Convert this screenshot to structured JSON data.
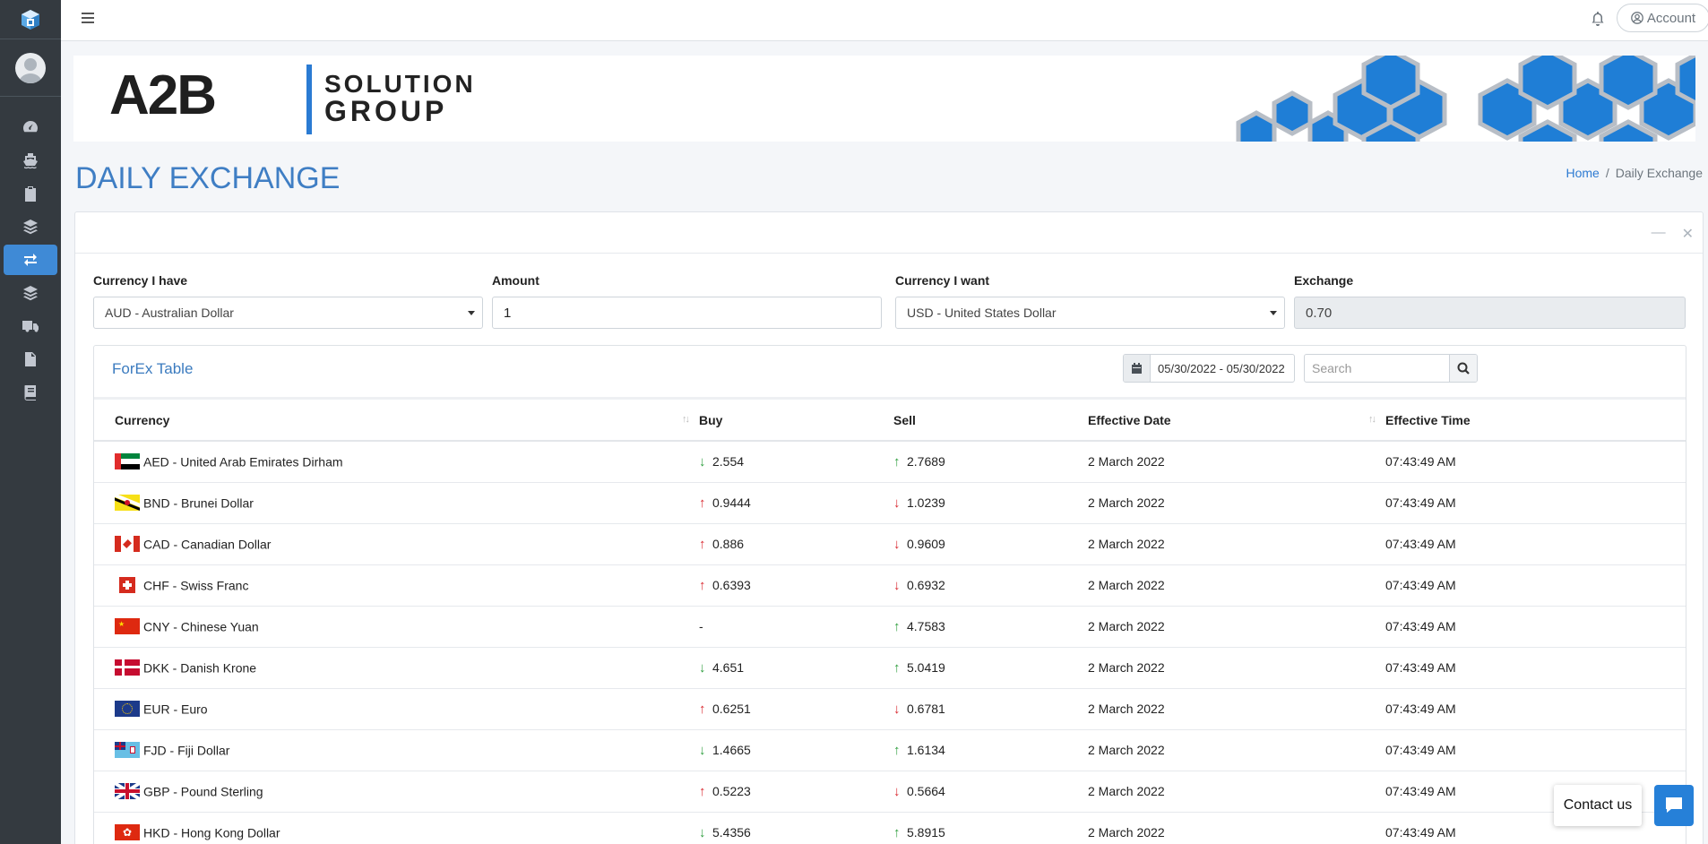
{
  "topbar": {
    "account_label": "Account"
  },
  "sidebar": {
    "items": [
      {
        "icon": "dashboard-icon"
      },
      {
        "icon": "ship-icon"
      },
      {
        "icon": "clipboard-check-icon"
      },
      {
        "icon": "layers-icon"
      },
      {
        "icon": "exchange-icon",
        "active": true
      },
      {
        "icon": "layers-icon"
      },
      {
        "icon": "truck-icon"
      },
      {
        "icon": "document-icon"
      },
      {
        "icon": "book-icon"
      }
    ]
  },
  "banner": {
    "logo_main": "A2B",
    "logo_line1": "SOLUTION",
    "logo_line2": "GROUP"
  },
  "page": {
    "title": "DAILY EXCHANGE",
    "breadcrumb_home": "Home",
    "breadcrumb_sep": "/",
    "breadcrumb_current": "Daily Exchange"
  },
  "converter": {
    "have_label": "Currency I have",
    "have_value": "AUD - Australian Dollar",
    "amount_label": "Amount",
    "amount_value": "1",
    "want_label": "Currency I want",
    "want_value": "USD - United States Dollar",
    "exchange_label": "Exchange",
    "exchange_value": "0.70"
  },
  "forex": {
    "title": "ForEx Table",
    "date_range": "05/30/2022 - 05/30/2022",
    "search_placeholder": "Search",
    "columns": [
      "Currency",
      "Buy",
      "Sell",
      "Effective Date",
      "Effective Time"
    ],
    "rows": [
      {
        "currency": "AED - United Arab Emirates Dirham",
        "flag": "ae",
        "buy": "2.554",
        "buy_dir": "down",
        "sell": "2.7689",
        "sell_dir": "up",
        "date": "2 March 2022",
        "time": "07:43:49 AM"
      },
      {
        "currency": "BND - Brunei Dollar",
        "flag": "bn",
        "buy": "0.9444",
        "buy_dir": "up",
        "sell": "1.0239",
        "sell_dir": "down",
        "date": "2 March 2022",
        "time": "07:43:49 AM"
      },
      {
        "currency": "CAD - Canadian Dollar",
        "flag": "ca",
        "buy": "0.886",
        "buy_dir": "up",
        "sell": "0.9609",
        "sell_dir": "down",
        "date": "2 March 2022",
        "time": "07:43:49 AM"
      },
      {
        "currency": "CHF - Swiss Franc",
        "flag": "ch",
        "buy": "0.6393",
        "buy_dir": "up",
        "sell": "0.6932",
        "sell_dir": "down",
        "date": "2 March 2022",
        "time": "07:43:49 AM"
      },
      {
        "currency": "CNY - Chinese Yuan",
        "flag": "cn",
        "buy": "-",
        "buy_dir": "none",
        "sell": "4.7583",
        "sell_dir": "up",
        "date": "2 March 2022",
        "time": "07:43:49 AM"
      },
      {
        "currency": "DKK - Danish Krone",
        "flag": "dk",
        "buy": "4.651",
        "buy_dir": "down",
        "sell": "5.0419",
        "sell_dir": "up",
        "date": "2 March 2022",
        "time": "07:43:49 AM"
      },
      {
        "currency": "EUR - Euro",
        "flag": "eu",
        "buy": "0.6251",
        "buy_dir": "up",
        "sell": "0.6781",
        "sell_dir": "down",
        "date": "2 March 2022",
        "time": "07:43:49 AM"
      },
      {
        "currency": "FJD - Fiji Dollar",
        "flag": "fj",
        "buy": "1.4665",
        "buy_dir": "down",
        "sell": "1.6134",
        "sell_dir": "up",
        "date": "2 March 2022",
        "time": "07:43:49 AM"
      },
      {
        "currency": "GBP - Pound Sterling",
        "flag": "gb",
        "buy": "0.5223",
        "buy_dir": "up",
        "sell": "0.5664",
        "sell_dir": "down",
        "date": "2 March 2022",
        "time": "07:43:49 AM"
      },
      {
        "currency": "HKD - Hong Kong Dollar",
        "flag": "hk",
        "buy": "5.4356",
        "buy_dir": "down",
        "sell": "5.8915",
        "sell_dir": "up",
        "date": "2 March 2022",
        "time": "07:43:49 AM"
      }
    ]
  },
  "contact": {
    "label": "Contact us"
  },
  "colors": {
    "accent": "#3f8ad6",
    "title": "#3f7ec4",
    "sidebar": "#343a40",
    "up_red": "#d9282f",
    "down_green": "#2e9e3d"
  }
}
